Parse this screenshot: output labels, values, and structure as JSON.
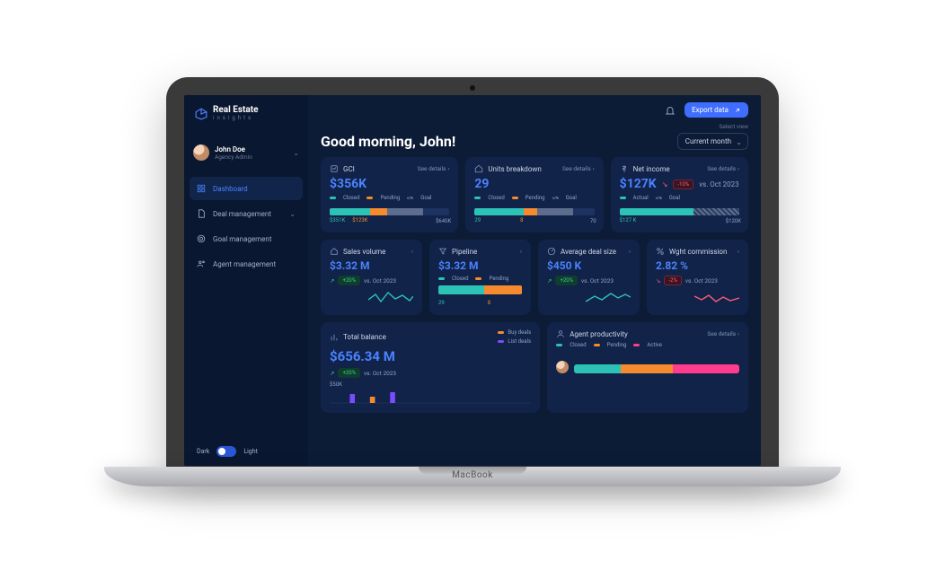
{
  "brand": {
    "title": "Real Estate",
    "subtitle": "insights"
  },
  "user": {
    "name": "John Doe",
    "role": "Agency Admin"
  },
  "nav": {
    "items": [
      {
        "label": "Dashboard"
      },
      {
        "label": "Deal management"
      },
      {
        "label": "Goal management"
      },
      {
        "label": "Agent management"
      }
    ]
  },
  "theme": {
    "dark": "Dark",
    "light": "Light"
  },
  "topbar": {
    "export": "Export data"
  },
  "header": {
    "greeting": "Good morning, John!",
    "select_label": "Select view",
    "select_value": "Current month"
  },
  "see_details": "See details",
  "cards": {
    "gci": {
      "title": "GCI",
      "value": "$356K",
      "legend": {
        "closed": "Closed",
        "pending": "Pending",
        "goal": "Goal"
      },
      "end_label": "$640K",
      "under": {
        "closed": "$351K",
        "pending": "$123K"
      }
    },
    "units": {
      "title": "Units breakdown",
      "value": "29",
      "legend": {
        "closed": "Closed",
        "pending": "Pending",
        "goal": "Goal"
      },
      "end_label": "70",
      "under": {
        "closed": "29",
        "pending": "8"
      }
    },
    "net": {
      "title": "Net income",
      "value": "$127K",
      "delta": "-10%",
      "delta_suffix": "vs. Oct 2023",
      "legend": {
        "actual": "Actual",
        "goal": "Goal"
      },
      "end_label": "$120K",
      "under": {
        "actual": "$127 K"
      }
    },
    "sales": {
      "title": "Sales volume",
      "value": "$3.32 M",
      "delta": "+20%",
      "delta_suffix": "vs. Oct 2023"
    },
    "pipeline": {
      "title": "Pipeline",
      "value": "$3.32 M",
      "legend": {
        "closed": "Closed",
        "pending": "Pending"
      },
      "under": {
        "closed": "29",
        "pending": "8"
      }
    },
    "avg_deal": {
      "title": "Average deal size",
      "value": "$450 K",
      "delta": "+20%",
      "delta_suffix": "vs. Oct 2023"
    },
    "wght": {
      "title": "Wght commission",
      "value": "2.82 %",
      "delta": "-2%",
      "delta_suffix": "vs. Oct 2023"
    },
    "total": {
      "title": "Total balance",
      "value": "$656.34 M",
      "delta": "+20%",
      "delta_suffix": "vs. Oct 2023",
      "axis": "$50K",
      "legend": {
        "buy": "Buy deals",
        "list": "List deals"
      }
    },
    "agent": {
      "title": "Agent productivity",
      "legend": {
        "closed": "Closed",
        "pending": "Pending",
        "active": "Active"
      }
    }
  },
  "laptop_brand": "MacBook"
}
